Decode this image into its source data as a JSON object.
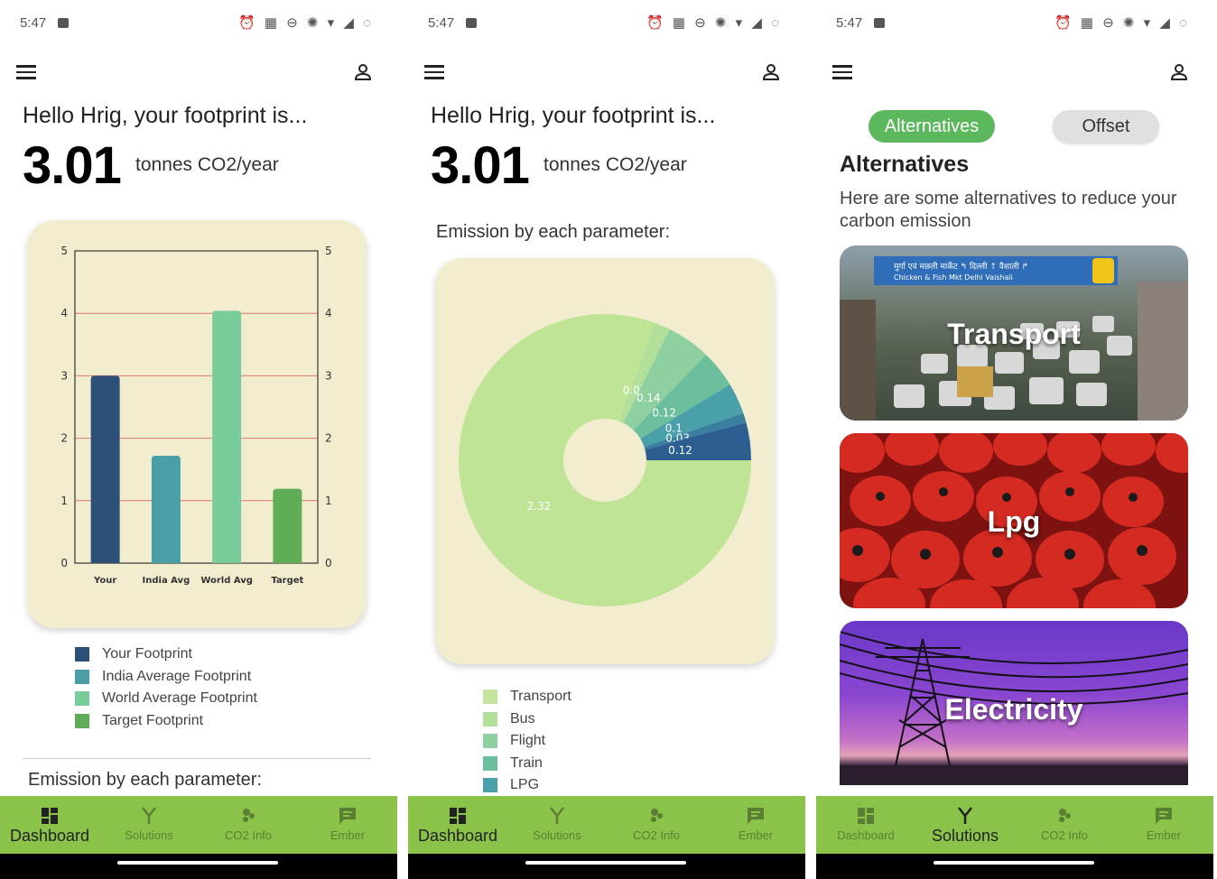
{
  "status": {
    "time": "5:47",
    "icons": "⏰ ▦ ⊖ ✺ ▾ ◢ ◌"
  },
  "screen1": {
    "greeting": "Hello Hrig, your footprint is...",
    "footprint_value": "3.01",
    "footprint_unit": "tonnes CO2/year",
    "legend": [
      {
        "label": "Your Footprint",
        "color": "#2c5077"
      },
      {
        "label": "India Average Footprint",
        "color": "#4a9ea6"
      },
      {
        "label": "World Average Footprint",
        "color": "#78cd9a"
      },
      {
        "label": "Target Footprint",
        "color": "#5fad56"
      }
    ],
    "section_label": "Emission by each parameter:"
  },
  "screen2": {
    "greeting": "Hello Hrig, your footprint is...",
    "footprint_value": "3.01",
    "footprint_unit": "tonnes CO2/year",
    "section_label": "Emission by each parameter:",
    "legend": [
      {
        "label": "Transport",
        "color": "#c4e59b"
      },
      {
        "label": "Bus",
        "color": "#b2e09a"
      },
      {
        "label": "Flight",
        "color": "#8fd0a0"
      },
      {
        "label": "Train",
        "color": "#6bbf9c"
      },
      {
        "label": "LPG",
        "color": "#4aa0a8"
      }
    ]
  },
  "screen3": {
    "tab_active": "Alternatives",
    "tab_inactive": "Offset",
    "title": "Alternatives",
    "description": "Here are some alternatives to reduce your carbon emission",
    "cards": [
      {
        "label": "Transport",
        "sign": "मुर्गा एवं मछली मार्केट ↰  दिल्ली ↑  वैशाली ↱",
        "sign2": "Chicken & Fish Mkt   Delhi   Vaishali"
      },
      {
        "label": "Lpg"
      },
      {
        "label": "Electricity"
      }
    ]
  },
  "nav": {
    "items": [
      "Dashboard",
      "Solutions",
      "CO2 Info",
      "Ember"
    ]
  },
  "chart_data": [
    {
      "type": "bar",
      "categories": [
        "Your",
        "India Avg",
        "World Avg",
        "Target"
      ],
      "values": [
        3.0,
        1.72,
        4.04,
        1.19
      ],
      "colors": [
        "#2c5077",
        "#4a9ea6",
        "#78cd9a",
        "#5fad56"
      ],
      "ylim": [
        0,
        5
      ],
      "yticks": [
        0,
        1,
        2,
        3,
        4,
        5
      ],
      "grid": true,
      "grid_color": "#e07a6e",
      "legend": [
        "Your Footprint",
        "India Average Footprint",
        "World Average Footprint",
        "Target Footprint"
      ]
    },
    {
      "type": "pie",
      "donut": true,
      "slices": [
        {
          "label": "2.32",
          "value": 2.32,
          "color": "#c0e496"
        },
        {
          "label": "0.05",
          "value": 0.05,
          "color": "#b2e09a"
        },
        {
          "label": "0.14",
          "value": 0.14,
          "color": "#8fd0a0"
        },
        {
          "label": "0.12",
          "value": 0.12,
          "color": "#6bbf9c"
        },
        {
          "label": "0.1",
          "value": 0.1,
          "color": "#4aa0a8"
        },
        {
          "label": "0.03",
          "value": 0.03,
          "color": "#3b7fa0"
        },
        {
          "label": "0.12",
          "value": 0.12,
          "color": "#2c5e92"
        }
      ]
    }
  ]
}
